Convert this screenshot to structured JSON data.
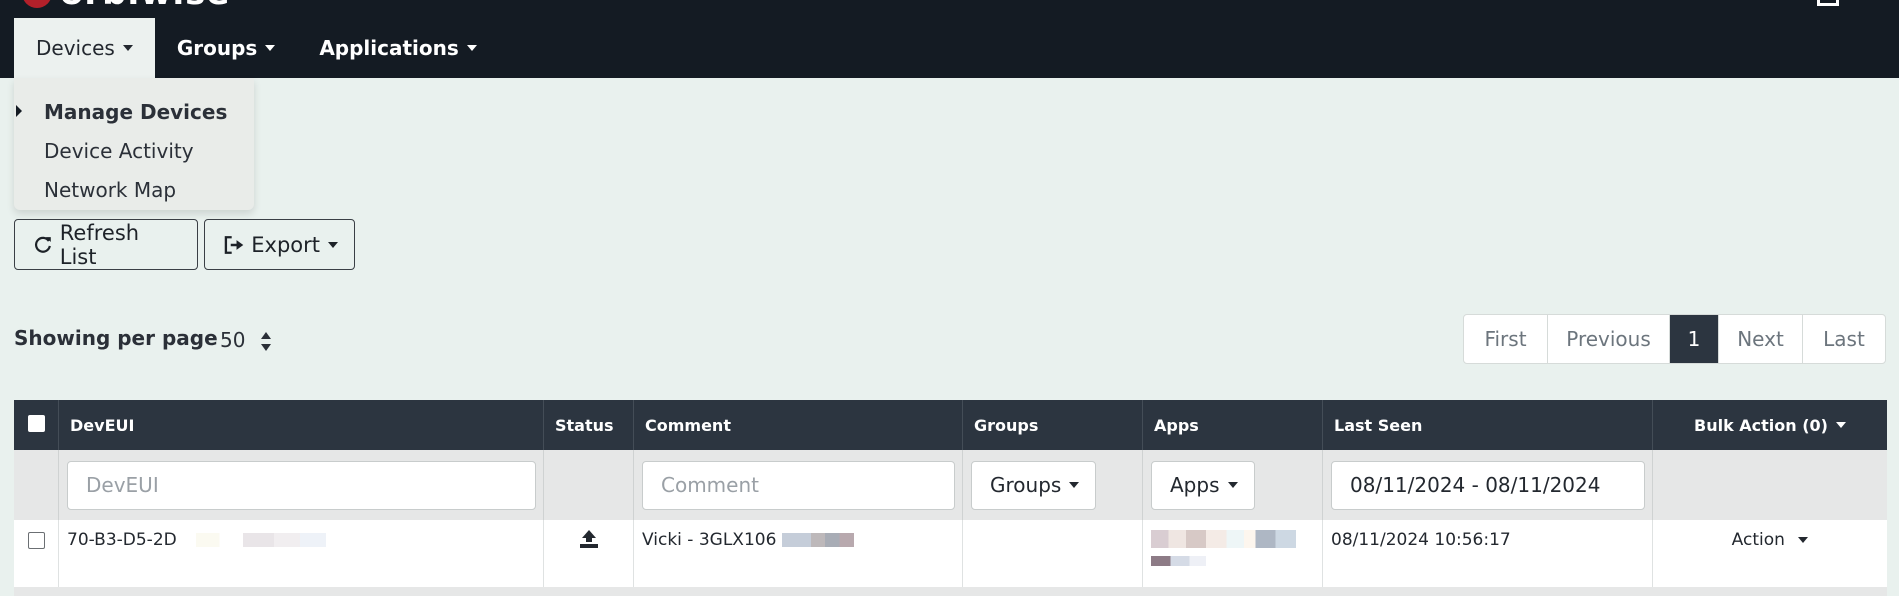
{
  "app": {
    "logo_text": "orbiwise",
    "logo_icon": "orbiwise-logo-icon",
    "top_right_icon": "box-icon"
  },
  "nav": {
    "items": [
      {
        "label": "Devices",
        "active": true
      },
      {
        "label": "Groups",
        "active": false
      },
      {
        "label": "Applications",
        "active": false
      }
    ]
  },
  "dropdown": {
    "items": [
      {
        "label": "Manage Devices",
        "current": true
      },
      {
        "label": "Device Activity",
        "current": false
      },
      {
        "label": "Network Map",
        "current": false
      }
    ]
  },
  "toolbar": {
    "refresh_label": "Refresh List",
    "refresh_icon": "refresh-icon",
    "export_label": "Export",
    "export_icon": "export-icon"
  },
  "perpage": {
    "label": "Showing per page",
    "value": "50"
  },
  "pagination": {
    "first": "First",
    "previous": "Previous",
    "current": "1",
    "next": "Next",
    "last": "Last"
  },
  "table": {
    "headers": {
      "deveui": "DevEUI",
      "status": "Status",
      "comment": "Comment",
      "groups": "Groups",
      "apps": "Apps",
      "last_seen": "Last Seen",
      "bulk_action": "Bulk Action (0)"
    },
    "filters": {
      "deveui_placeholder": "DevEUI",
      "comment_placeholder": "Comment",
      "groups_label": "Groups",
      "apps_label": "Apps",
      "date_range": "08/11/2024 - 08/11/2024"
    },
    "rows": [
      {
        "deveui": "70-B3-D5-2D",
        "status_icon": "upload-icon",
        "comment": "Vicki - 3GLX106",
        "groups": "",
        "last_seen": "08/11/2024 10:56:17",
        "action": "Action"
      }
    ]
  },
  "colors": {
    "header_bg": "#141b23",
    "table_header_bg": "#2c3540",
    "page_bg": "#e9f1ee",
    "logo_red": "#b3202a"
  }
}
